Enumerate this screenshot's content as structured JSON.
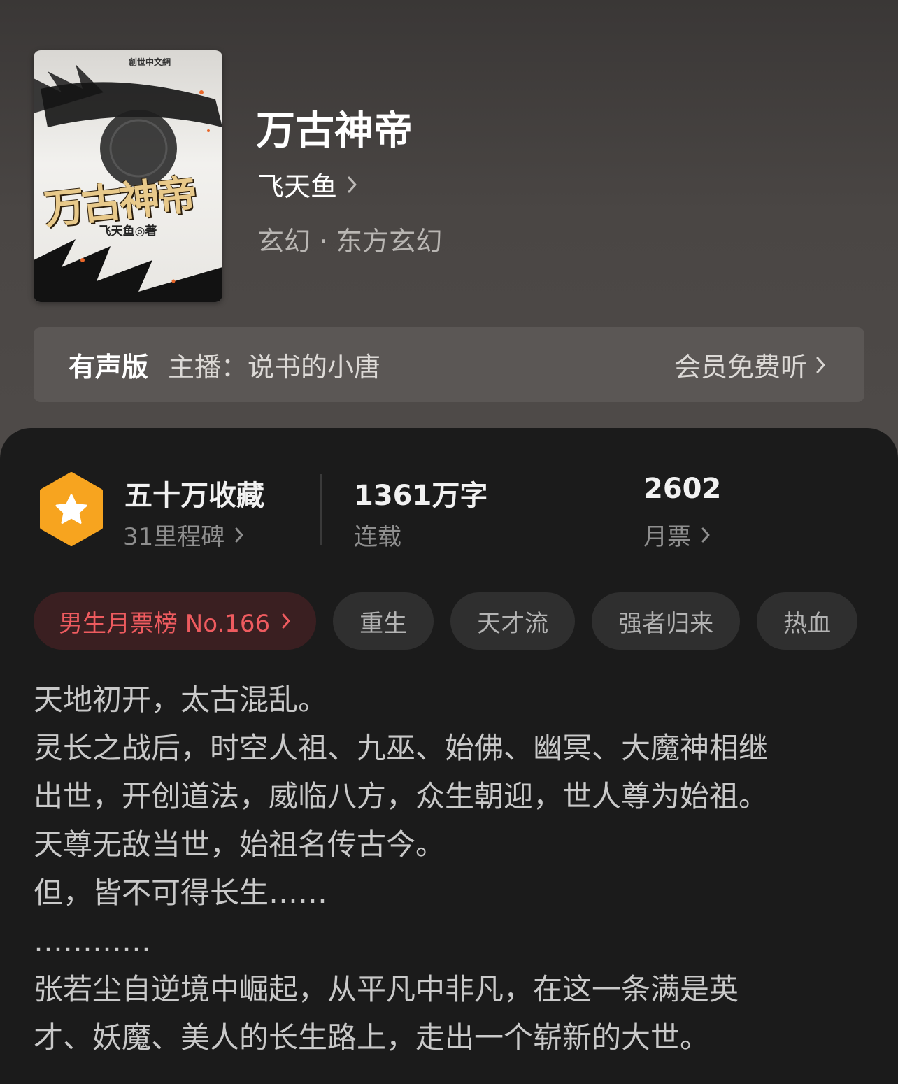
{
  "book": {
    "title": "万古神帝",
    "author": "飞天鱼",
    "genre": "玄幻 · 东方玄幻",
    "cover": {
      "title_art": "万古神帝",
      "author_line": "飞天鱼◎著",
      "publisher": "創世中文網"
    }
  },
  "audio": {
    "tag": "有声版",
    "anchor": "主播：说书的小唐",
    "action": "会员免费听"
  },
  "stats": {
    "favorites": "五十万收藏",
    "milestones": "31里程碑",
    "words": "1361万字",
    "status": "连载",
    "monthly_votes": "2602",
    "monthly_votes_label": "月票"
  },
  "tags": {
    "rank": "男生月票榜 No.166",
    "items": [
      "重生",
      "天才流",
      "强者归来",
      "热血"
    ]
  },
  "synopsis": [
    "天地初开，太古混乱。",
    "灵长之战后，时空人祖、九巫、始佛、幽冥、大魔神相继",
    "出世，开创道法，威临八方，众生朝迎，世人尊为始祖。",
    "天尊无敌当世，始祖名传古今。",
    "但，皆不可得长生……",
    "…………",
    "张若尘自逆境中崛起，从平凡中非凡，在这一条满是英",
    "才、妖魔、美人的长生路上，走出一个崭新的大世。"
  ],
  "colors": {
    "accent_red": "#ee5b5f",
    "badge_orange": "#f7a41f"
  }
}
